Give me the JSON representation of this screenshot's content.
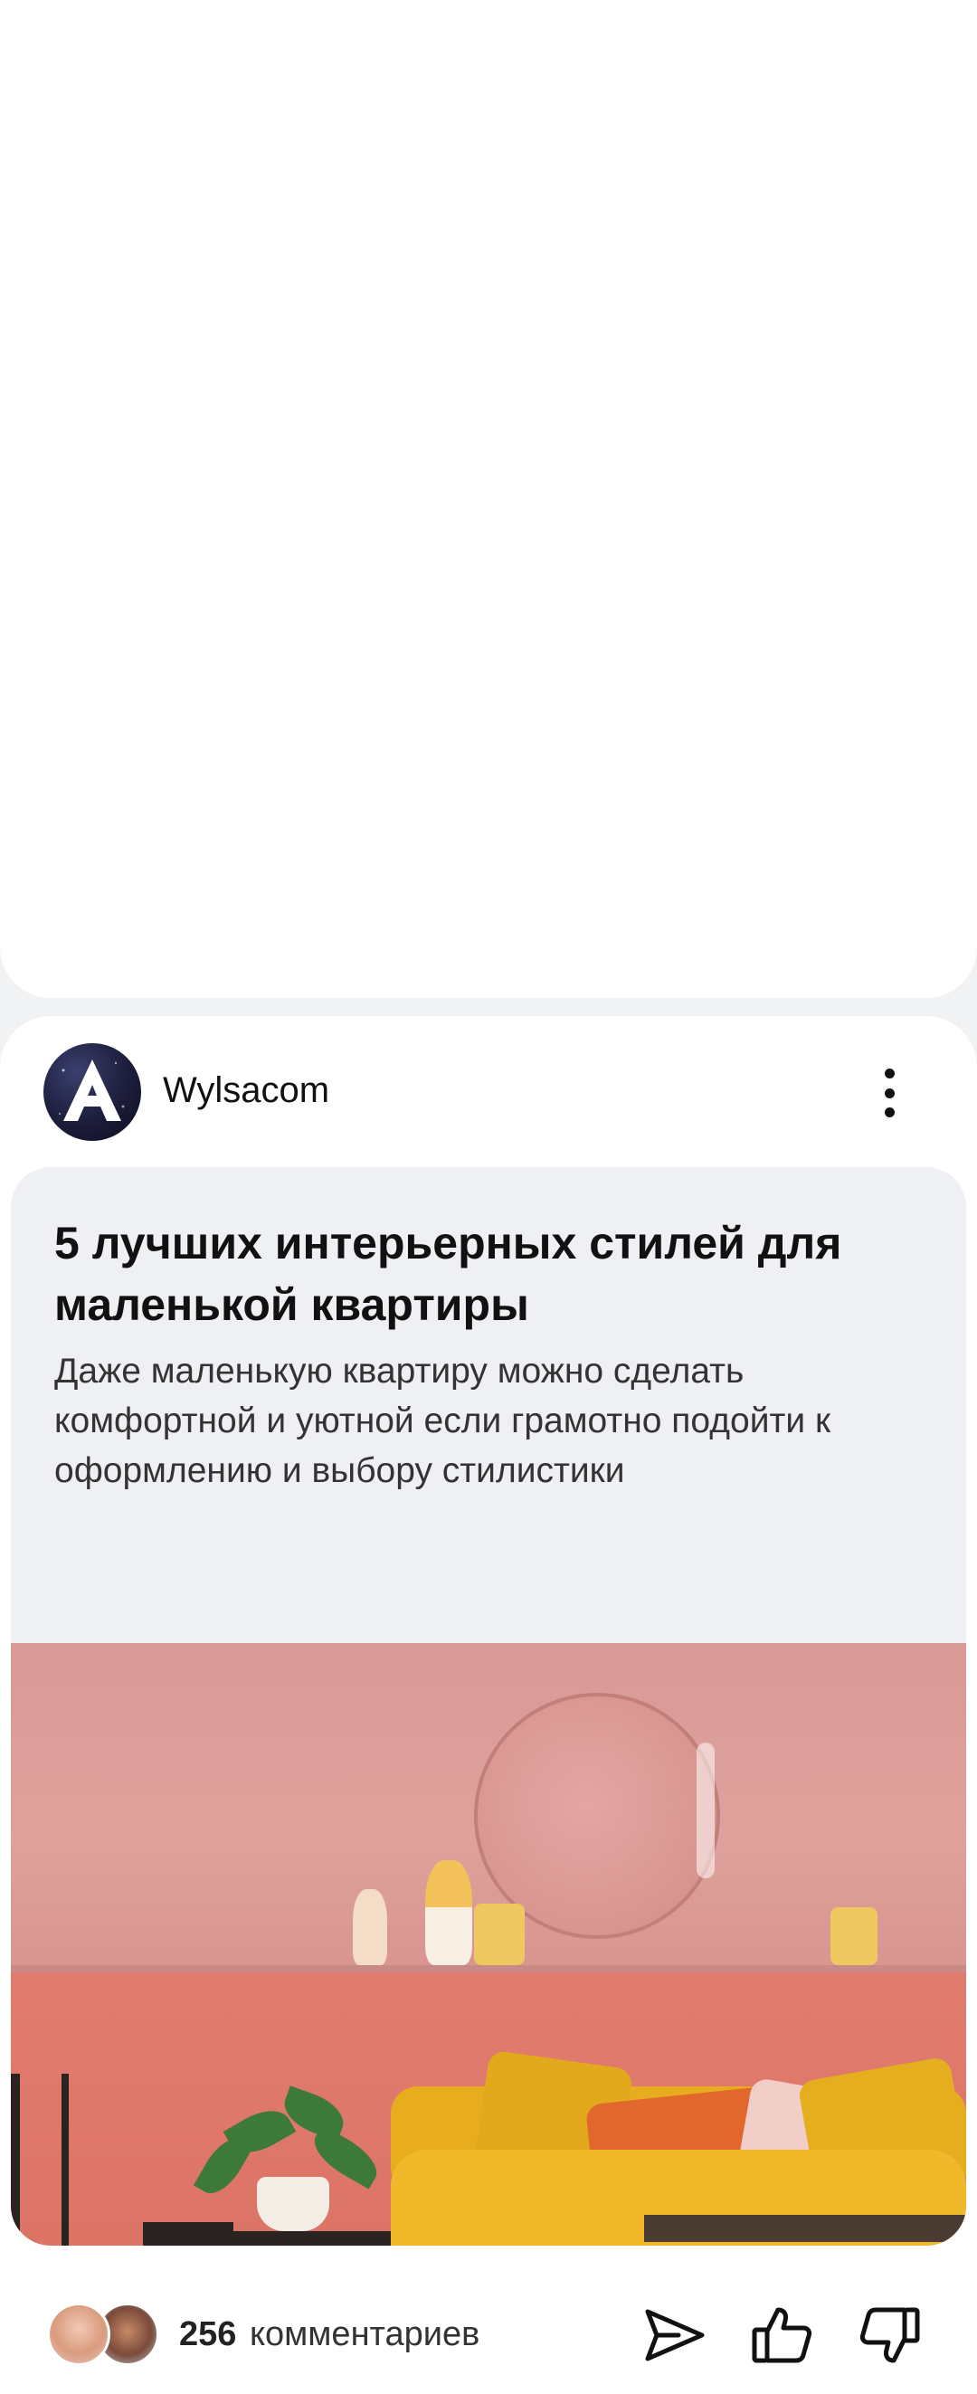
{
  "channel": {
    "name": "Wylsacom",
    "logo_letter": "A"
  },
  "article": {
    "title": "5 лучших интерьерных стилей для маленькой квартиры",
    "description": "Даже маленькую квартиру можно сделать комфортной и уютной если грамотно подойти к оформлению и выбору стилистики"
  },
  "footer": {
    "comments_count": "256",
    "comments_label": "комментариев"
  },
  "icons": {
    "more": "more-vertical-icon",
    "share": "send-icon",
    "like": "thumbs-up-icon",
    "dislike": "thumbs-down-icon"
  },
  "colors": {
    "page_background": "#f1f2f4",
    "card_background": "#ffffff",
    "article_background": "#eff0f3",
    "text_primary": "#111111"
  }
}
